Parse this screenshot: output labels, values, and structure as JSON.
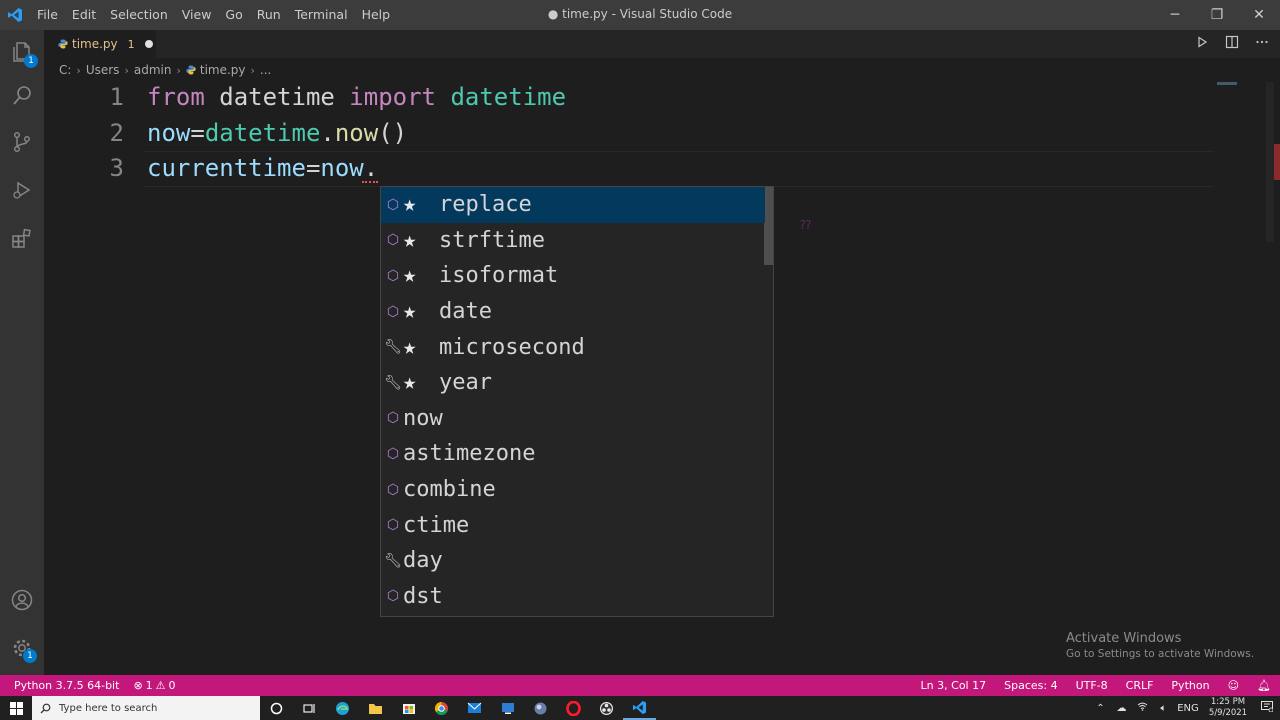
{
  "titlebar": {
    "menu": [
      "File",
      "Edit",
      "Selection",
      "View",
      "Go",
      "Run",
      "Terminal",
      "Help"
    ],
    "title": "● time.py - Visual Studio Code",
    "controls": {
      "minimize": "─",
      "restore": "❐",
      "close": "✕"
    }
  },
  "activitybar": {
    "explorer_badge": "1",
    "manage_badge": "1"
  },
  "tab": {
    "name": "time.py",
    "problem_count": "1"
  },
  "breadcrumb": {
    "parts": [
      "C:",
      "Users",
      "admin",
      "time.py",
      "..."
    ]
  },
  "editor": {
    "lines": [
      {
        "number": "1",
        "tokens": [
          {
            "text": "from",
            "kind": "kw"
          },
          {
            "text": " datetime ",
            "kind": "plain"
          },
          {
            "text": "import",
            "kind": "kw"
          },
          {
            "text": " ",
            "kind": "plain"
          },
          {
            "text": "datetime",
            "kind": "cls"
          }
        ]
      },
      {
        "number": "2",
        "tokens": [
          {
            "text": "now",
            "kind": "var"
          },
          {
            "text": "=",
            "kind": "plain"
          },
          {
            "text": "datetime",
            "kind": "cls"
          },
          {
            "text": ".",
            "kind": "plain"
          },
          {
            "text": "now",
            "kind": "fn"
          },
          {
            "text": "()",
            "kind": "plain"
          }
        ]
      },
      {
        "number": "3",
        "tokens": [
          {
            "text": "currenttime",
            "kind": "var"
          },
          {
            "text": "=",
            "kind": "plain"
          },
          {
            "text": "now",
            "kind": "var"
          },
          {
            "text": ".",
            "kind": "plain"
          }
        ]
      }
    ]
  },
  "suggestions": [
    {
      "label": "replace",
      "kind": "method",
      "starred": true,
      "selected": true
    },
    {
      "label": "strftime",
      "kind": "method",
      "starred": true,
      "selected": false
    },
    {
      "label": "isoformat",
      "kind": "method",
      "starred": true,
      "selected": false
    },
    {
      "label": "date",
      "kind": "method",
      "starred": true,
      "selected": false
    },
    {
      "label": "microsecond",
      "kind": "field",
      "starred": true,
      "selected": false
    },
    {
      "label": "year",
      "kind": "field",
      "starred": true,
      "selected": false
    },
    {
      "label": "now",
      "kind": "method",
      "starred": false,
      "selected": false
    },
    {
      "label": "astimezone",
      "kind": "method",
      "starred": false,
      "selected": false
    },
    {
      "label": "combine",
      "kind": "method",
      "starred": false,
      "selected": false
    },
    {
      "label": "ctime",
      "kind": "method",
      "starred": false,
      "selected": false
    },
    {
      "label": "day",
      "kind": "field",
      "starred": false,
      "selected": false
    },
    {
      "label": "dst",
      "kind": "method",
      "starred": false,
      "selected": false
    }
  ],
  "watermark": {
    "title": "Activate Windows",
    "subtitle": "Go to Settings to activate Windows."
  },
  "statusbar": {
    "interpreter": "Python 3.7.5 64-bit",
    "errors": "1",
    "warnings": "0",
    "position": "Ln 3, Col 17",
    "indent": "Spaces: 4",
    "encoding": "UTF-8",
    "eol": "CRLF",
    "language": "Python"
  },
  "taskbar": {
    "search_placeholder": "Type here to search",
    "language": "ENG",
    "time": "1:25 PM",
    "date": "5/9/2021"
  },
  "colors": {
    "statusbar": "#c4177b",
    "selection": "#04395e",
    "keyword": "#c586c0",
    "class": "#4ec9b0",
    "variable": "#9cdcfe",
    "function": "#dcdcaa"
  }
}
